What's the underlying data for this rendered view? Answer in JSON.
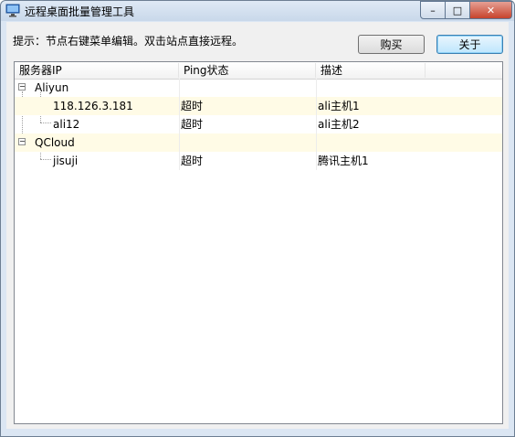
{
  "window": {
    "title": "远程桌面批量管理工具",
    "controls": {
      "minimize": "–",
      "maximize": "□",
      "close": "✕"
    }
  },
  "hint": "提示：节点右键菜单编辑。双击站点直接远程。",
  "buttons": {
    "buy": "购买",
    "about": "关于"
  },
  "table": {
    "columns": [
      "服务器IP",
      "Ping状态",
      "描述",
      ""
    ],
    "rows": [
      {
        "level": 0,
        "name": "Aliyun",
        "ping": "",
        "desc": "",
        "expanded": true
      },
      {
        "level": 1,
        "name": "118.126.3.181",
        "ping": "超时",
        "desc": "ali主机1"
      },
      {
        "level": 1,
        "name": "ali12",
        "ping": "超时",
        "desc": "ali主机2"
      },
      {
        "level": 0,
        "name": "QCloud",
        "ping": "",
        "desc": "",
        "expanded": true
      },
      {
        "level": 1,
        "name": "jisuji",
        "ping": "超时",
        "desc": "腾讯主机1"
      }
    ]
  },
  "expander_symbol": "−"
}
